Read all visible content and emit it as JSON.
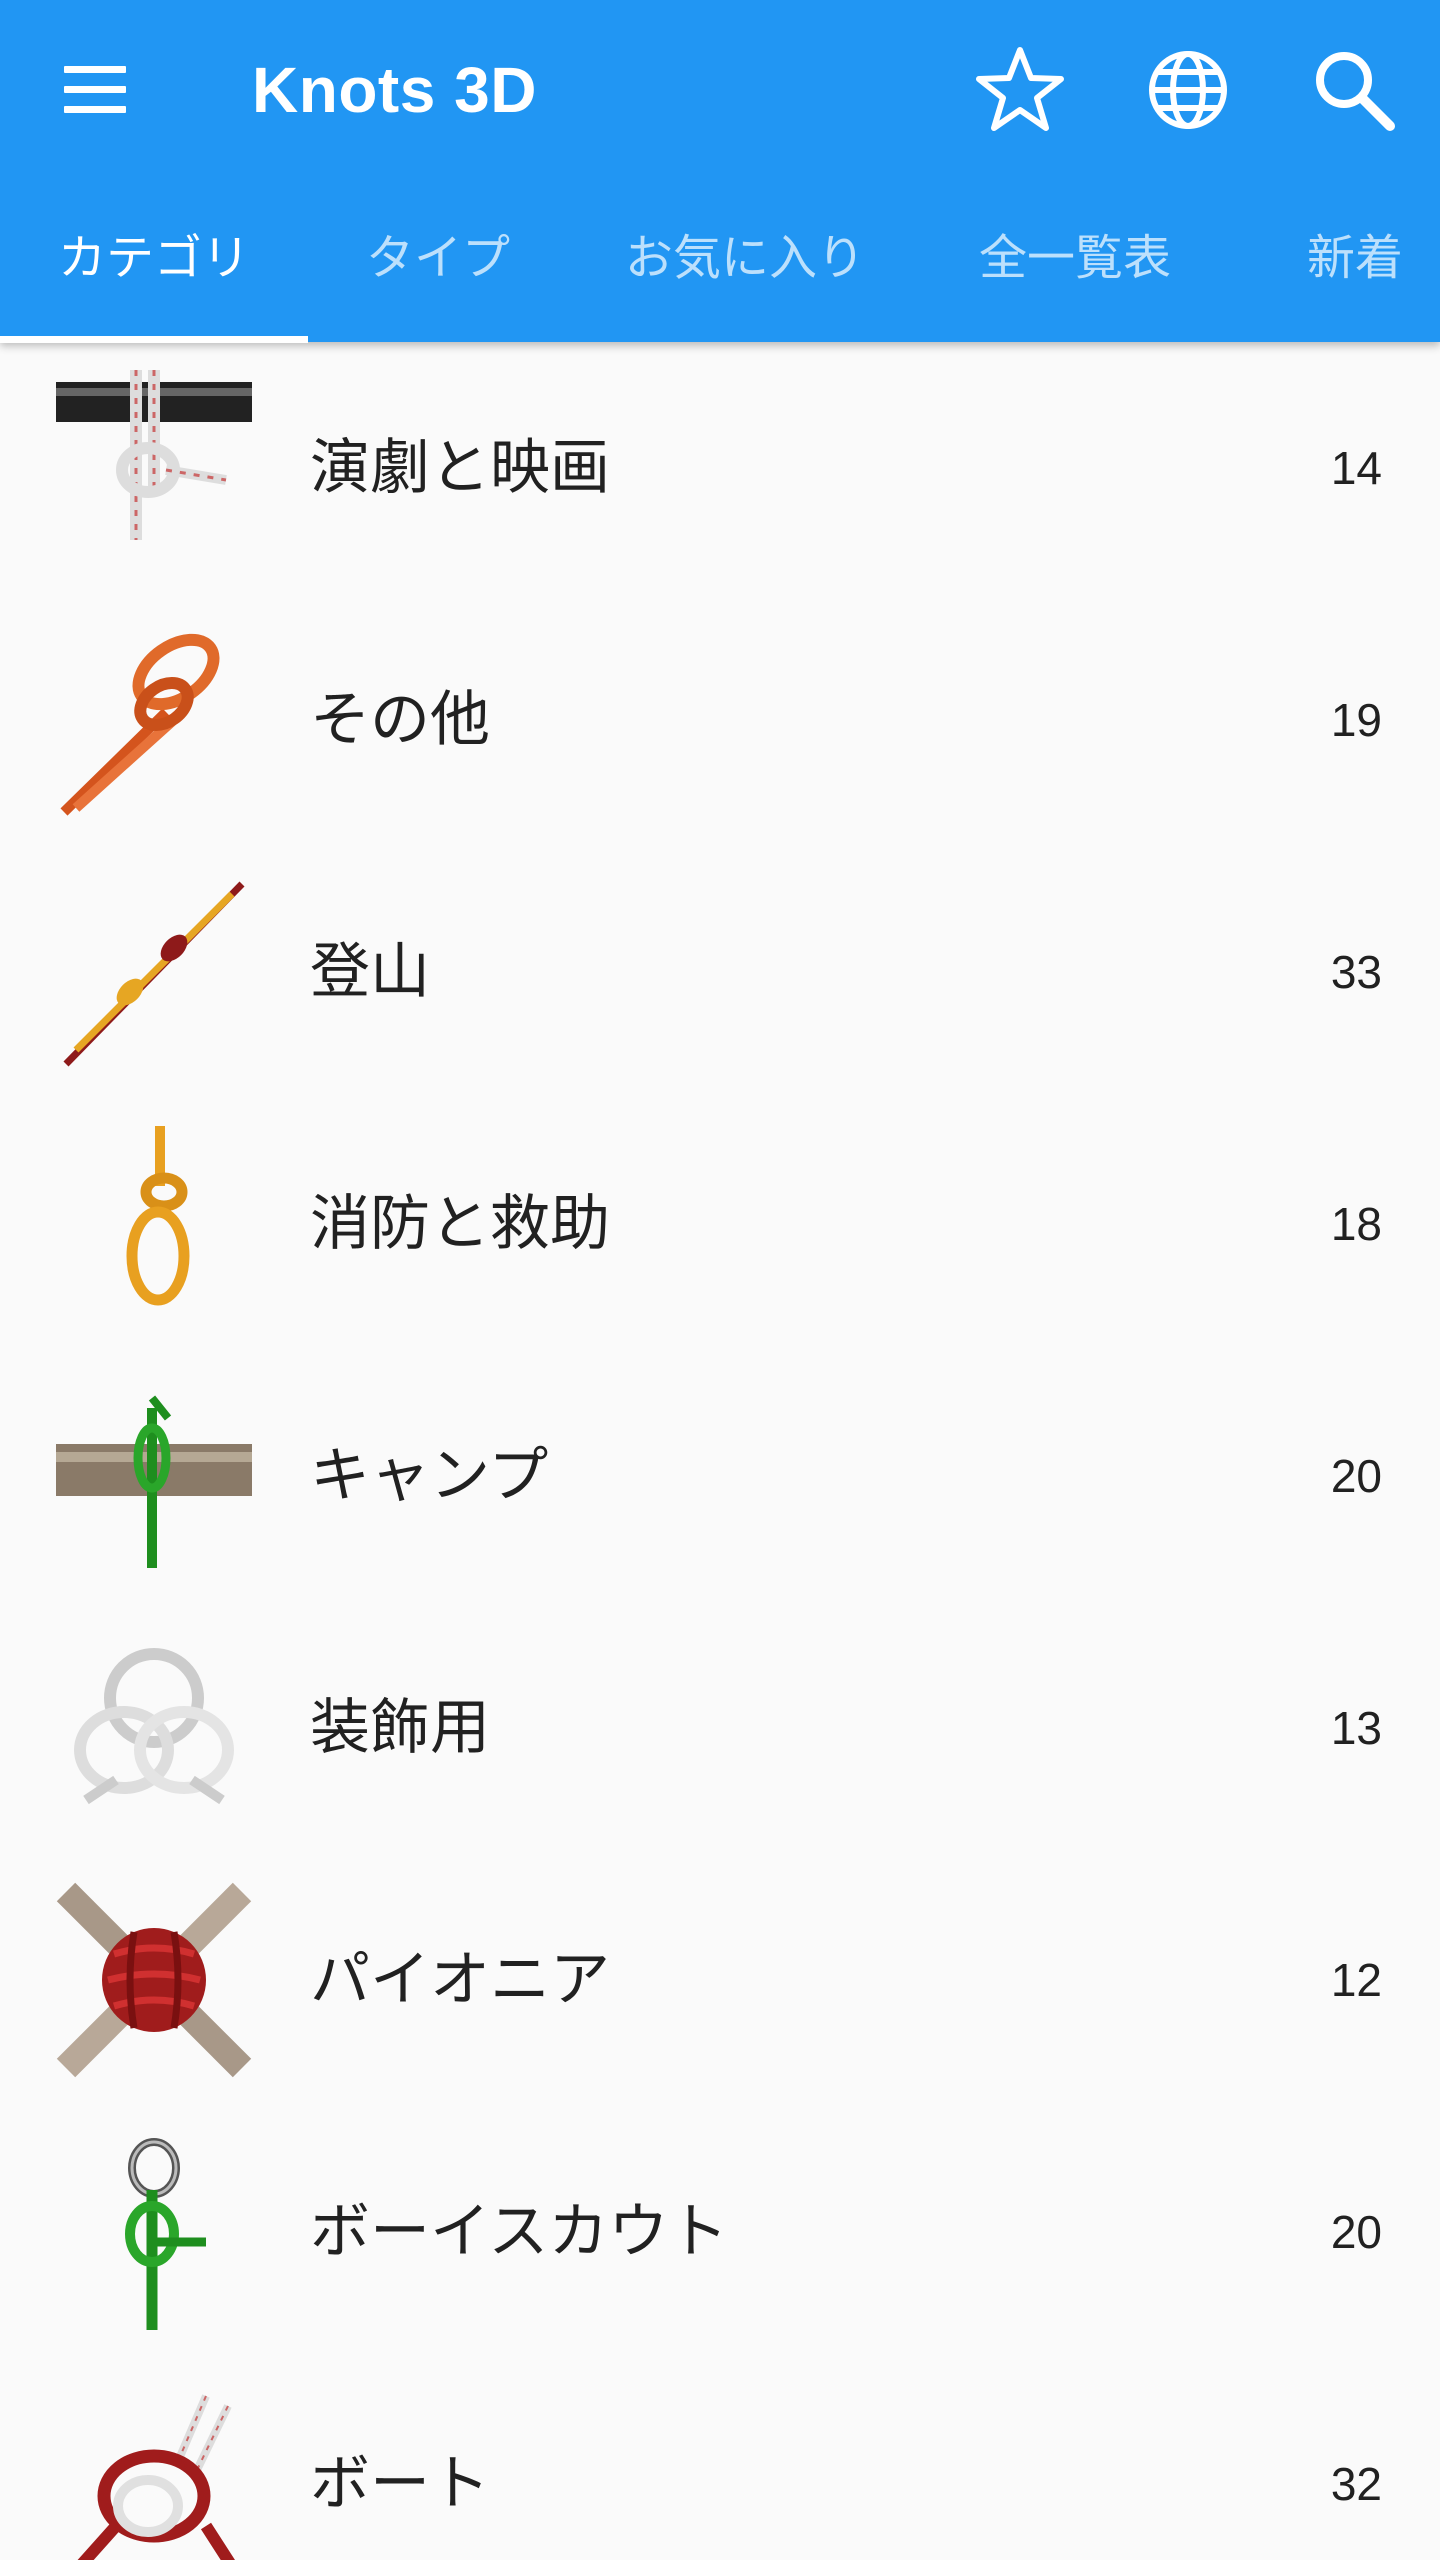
{
  "app": {
    "title": "Knots 3D"
  },
  "colors": {
    "primary": "#2196f3",
    "background": "#fafafa",
    "text": "#212121"
  },
  "toolbar": {
    "icons": [
      "menu-icon",
      "star-icon",
      "globe-icon",
      "search-icon"
    ]
  },
  "tabs": [
    {
      "label": "カテゴリ",
      "active": true
    },
    {
      "label": "タイプ",
      "active": false
    },
    {
      "label": "お気に入り",
      "active": false
    },
    {
      "label": "全一覧表",
      "active": false
    },
    {
      "label": "新着",
      "active": false
    }
  ],
  "categories": [
    {
      "label": "演劇と映画",
      "count": "14",
      "icon": "theater-knot-thumbnail"
    },
    {
      "label": "その他",
      "count": "19",
      "icon": "other-knot-thumbnail"
    },
    {
      "label": "登山",
      "count": "33",
      "icon": "climbing-knot-thumbnail"
    },
    {
      "label": "消防と救助",
      "count": "18",
      "icon": "rescue-knot-thumbnail"
    },
    {
      "label": "キャンプ",
      "count": "20",
      "icon": "camping-knot-thumbnail"
    },
    {
      "label": "装飾用",
      "count": "13",
      "icon": "decorative-knot-thumbnail"
    },
    {
      "label": "パイオニア",
      "count": "12",
      "icon": "pioneering-knot-thumbnail"
    },
    {
      "label": "ボーイスカウト",
      "count": "20",
      "icon": "scouting-knot-thumbnail"
    },
    {
      "label": "ボート",
      "count": "32",
      "icon": "boating-knot-thumbnail"
    }
  ]
}
